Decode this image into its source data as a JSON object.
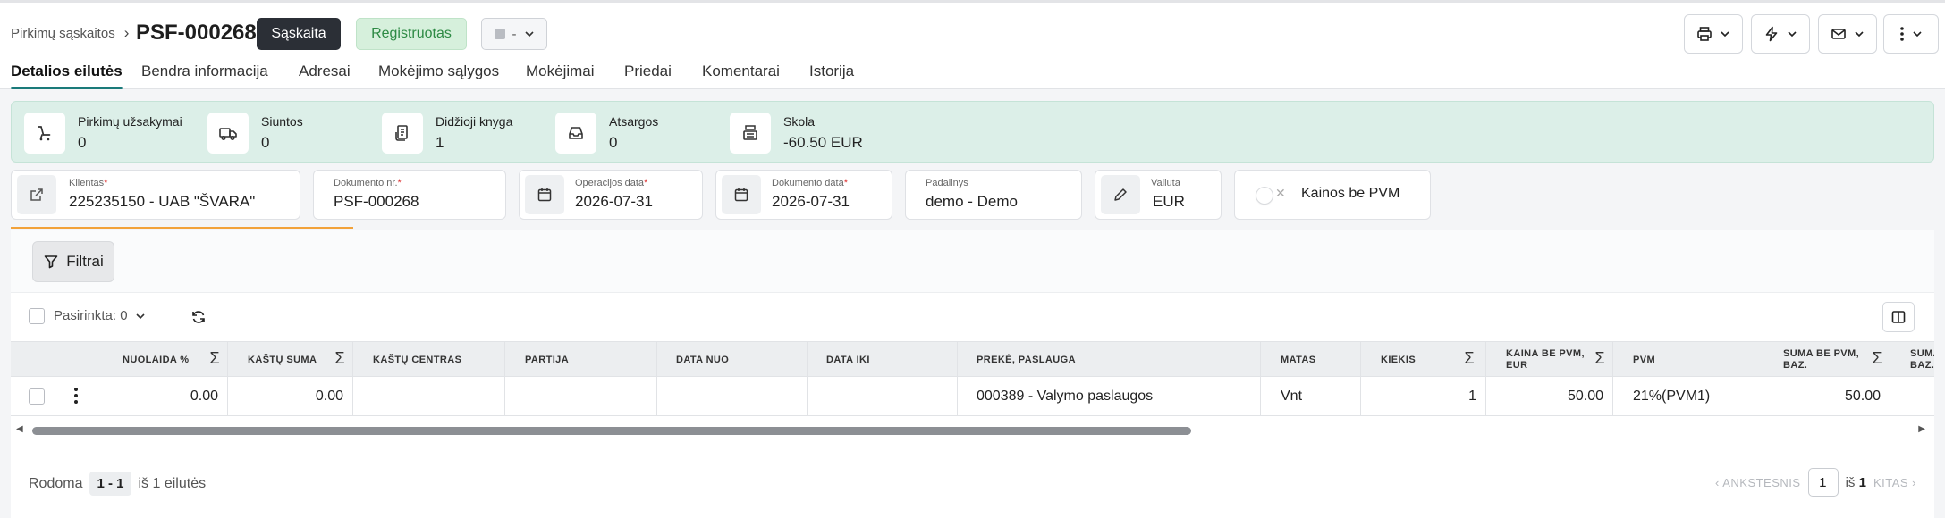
{
  "header": {
    "breadcrumb": "Pirkimų sąskaitos",
    "doc_number": "PSF-000268",
    "doc_type": "Sąskaita",
    "status": "Registruotas",
    "status_select": "-"
  },
  "tabs": [
    {
      "label": "Detalios eilutės",
      "active": true
    },
    {
      "label": "Bendra informacija"
    },
    {
      "label": "Adresai"
    },
    {
      "label": "Mokėjimo sąlygos"
    },
    {
      "label": "Mokėjimai"
    },
    {
      "label": "Priedai"
    },
    {
      "label": "Komentarai"
    },
    {
      "label": "Istorija"
    }
  ],
  "summary": [
    {
      "label": "Pirkimų užsakymai",
      "value": "0",
      "icon": "cart-icon"
    },
    {
      "label": "Siuntos",
      "value": "0",
      "icon": "truck-icon"
    },
    {
      "label": "Didžioji knyga",
      "value": "1",
      "icon": "ledger-icon"
    },
    {
      "label": "Atsargos",
      "value": "0",
      "icon": "inbox-icon"
    },
    {
      "label": "Skola",
      "value": "-60.50 EUR",
      "icon": "cash-register-icon"
    }
  ],
  "form": {
    "client": {
      "label": "Klientas",
      "value": "225235150 - UAB \"ŠVARA\""
    },
    "doc_no": {
      "label": "Dokumento nr.",
      "value": "PSF-000268"
    },
    "op_date": {
      "label": "Operacijos data",
      "value": "2026-07-31"
    },
    "doc_date": {
      "label": "Dokumento data",
      "value": "2026-07-31"
    },
    "department": {
      "label": "Padalinys",
      "value": "demo - Demo"
    },
    "currency": {
      "label": "Valiuta",
      "value": "EUR"
    },
    "prices_no_vat": {
      "label": "Kainos be PVM",
      "enabled": false
    },
    "required_mark": "*"
  },
  "toolbar": {
    "filter_label": "Filtrai",
    "selected_label": "Pasirinkta: 0"
  },
  "table": {
    "columns": [
      {
        "label": "NUOLAIDA %",
        "sum": true
      },
      {
        "label": "KAŠTŲ SUMA",
        "sum": true
      },
      {
        "label": "KAŠTŲ CENTRAS"
      },
      {
        "label": "PARTIJA"
      },
      {
        "label": "DATA NUO"
      },
      {
        "label": "DATA IKI"
      },
      {
        "label": "PREKĖ, PASLAUGA"
      },
      {
        "label": "MATAS"
      },
      {
        "label": "KIEKIS",
        "sum": true
      },
      {
        "label1": "KAINA BE PVM,",
        "label2": "EUR",
        "sum": true
      },
      {
        "label": "PVM"
      },
      {
        "label1": "SUMA BE PVM,",
        "label2": "BAZ.",
        "sum": true
      },
      {
        "label1": "SUMA",
        "label2": "BAZ."
      }
    ],
    "sum_symbol": "Σ",
    "rows": [
      {
        "discount": "0.00",
        "cost_sum": "0.00",
        "cost_center": "",
        "batch": "",
        "date_from": "",
        "date_to": "",
        "item": "000389 - Valymo paslaugos",
        "unit": "Vnt",
        "qty": "1",
        "price": "50.00",
        "vat": "21%(PVM1)",
        "sum_base": "50.00"
      }
    ]
  },
  "footer": {
    "showing_label": "Rodoma",
    "range": "1 - 1",
    "of_text": "iš 1 eilutės",
    "prev_label": "ANKSTESNIS",
    "page": "1",
    "of_pages_prefix": "iš",
    "of_pages": "1",
    "next_label": "KITAS"
  }
}
